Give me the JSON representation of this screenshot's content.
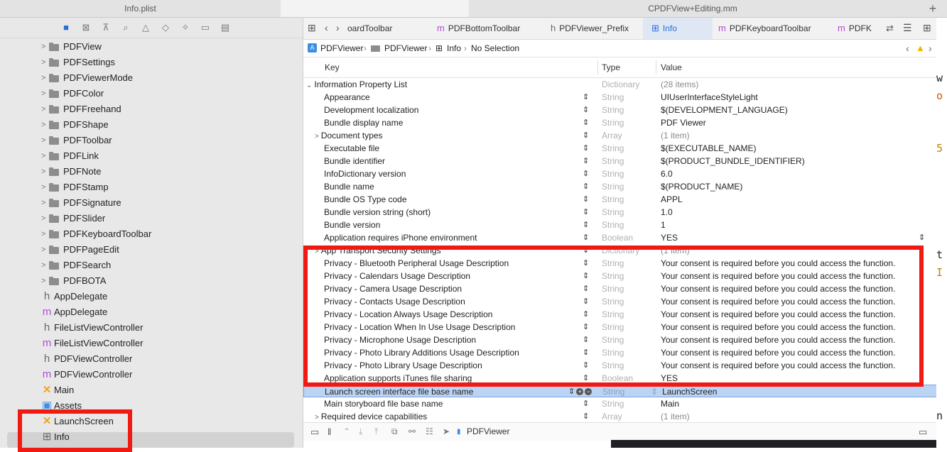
{
  "window_tabs": {
    "left": "Info.plist",
    "right": "CPDFView+Editing.mm",
    "plus": "+"
  },
  "navigator": {
    "toolbar_icons": [
      "folder-icon",
      "source-control-icon",
      "symbol-icon",
      "find-icon",
      "issue-icon",
      "test-icon",
      "debug-icon",
      "breakpoint-icon",
      "report-icon"
    ],
    "folders": [
      "PDFView",
      "PDFSettings",
      "PDFViewerMode",
      "PDFColor",
      "PDFFreehand",
      "PDFShape",
      "PDFToolbar",
      "PDFLink",
      "PDFNote",
      "PDFStamp",
      "PDFSignature",
      "PDFSlider",
      "PDFKeyboardToolbar",
      "PDFPageEdit",
      "PDFSearch",
      "PDFBOTA"
    ],
    "files": [
      {
        "icon": "h",
        "name": "AppDelegate"
      },
      {
        "icon": "m",
        "name": "AppDelegate"
      },
      {
        "icon": "h",
        "name": "FileListViewController"
      },
      {
        "icon": "m",
        "name": "FileListViewController"
      },
      {
        "icon": "h",
        "name": "PDFViewController"
      },
      {
        "icon": "m",
        "name": "PDFViewController"
      },
      {
        "icon": "✕",
        "name": "Main"
      },
      {
        "icon": "▣",
        "name": "Assets"
      },
      {
        "icon": "✕",
        "name": "LaunchScreen"
      },
      {
        "icon": "⊞",
        "name": "Info"
      }
    ]
  },
  "editor_tabs": [
    {
      "icon": "",
      "label": "oardToolbar"
    },
    {
      "icon": "m",
      "label": "PDFBottomToolbar"
    },
    {
      "icon": "h",
      "label": "PDFViewer_Prefix"
    },
    {
      "icon": "⊞",
      "label": "Info"
    },
    {
      "icon": "m",
      "label": "PDFKeyboardToolbar"
    },
    {
      "icon": "m",
      "label": "PDFK"
    }
  ],
  "jumpbar": {
    "project": "PDFViewer",
    "group": "PDFViewer",
    "file": "Info",
    "selection": "No Selection"
  },
  "columns": {
    "key": "Key",
    "type": "Type",
    "value": "Value"
  },
  "plist": {
    "root": {
      "key": "Information Property List",
      "type": "Dictionary",
      "value": "(28 items)"
    },
    "rows": [
      {
        "key": "Appearance",
        "type": "String",
        "value": "UIUserInterfaceStyleLight"
      },
      {
        "key": "Development localization",
        "type": "String",
        "value": "$(DEVELOPMENT_LANGUAGE)"
      },
      {
        "key": "Bundle display name",
        "type": "String",
        "value": "PDF Viewer"
      },
      {
        "key": "Document types",
        "type": "Array",
        "value": "(1 item)",
        "expandable": true
      },
      {
        "key": "Executable file",
        "type": "String",
        "value": "$(EXECUTABLE_NAME)"
      },
      {
        "key": "Bundle identifier",
        "type": "String",
        "value": "$(PRODUCT_BUNDLE_IDENTIFIER)"
      },
      {
        "key": "InfoDictionary version",
        "type": "String",
        "value": "6.0"
      },
      {
        "key": "Bundle name",
        "type": "String",
        "value": "$(PRODUCT_NAME)"
      },
      {
        "key": "Bundle OS Type code",
        "type": "String",
        "value": "APPL"
      },
      {
        "key": "Bundle version string (short)",
        "type": "String",
        "value": "1.0"
      },
      {
        "key": "Bundle version",
        "type": "String",
        "value": "1"
      },
      {
        "key": "Application requires iPhone environment",
        "type": "Boolean",
        "value": "YES",
        "stepper2": true
      },
      {
        "key": "App Transport Security Settings",
        "type": "Dictionary",
        "value": "(1 item)",
        "expandable": true
      },
      {
        "key": "Privacy - Bluetooth Peripheral Usage Description",
        "type": "String",
        "value": "Your consent is required before you could access the function."
      },
      {
        "key": "Privacy - Calendars Usage Description",
        "type": "String",
        "value": "Your consent is required before you could access the function."
      },
      {
        "key": "Privacy - Camera Usage Description",
        "type": "String",
        "value": "Your consent is required before you could access the function."
      },
      {
        "key": "Privacy - Contacts Usage Description",
        "type": "String",
        "value": "Your consent is required before you could access the function."
      },
      {
        "key": "Privacy - Location Always Usage Description",
        "type": "String",
        "value": "Your consent is required before you could access the function."
      },
      {
        "key": "Privacy - Location When In Use Usage Description",
        "type": "String",
        "value": "Your consent is required before you could access the function."
      },
      {
        "key": "Privacy - Microphone Usage Description",
        "type": "String",
        "value": "Your consent is required before you could access the function."
      },
      {
        "key": "Privacy - Photo Library Additions Usage Description",
        "type": "String",
        "value": "Your consent is required before you could access the function."
      },
      {
        "key": "Privacy - Photo Library Usage Description",
        "type": "String",
        "value": "Your consent is required before you could access the function."
      },
      {
        "key": "Application supports iTunes file sharing",
        "type": "Boolean",
        "value": "YES",
        "stepper2": true
      },
      {
        "key": "Launch screen interface file base name",
        "type": "String",
        "value": "LaunchScreen",
        "selected": true
      },
      {
        "key": "Main storyboard file base name",
        "type": "String",
        "value": "Main"
      },
      {
        "key": "Required device capabilities",
        "type": "Array",
        "value": "(1 item)",
        "expandable": true
      }
    ]
  },
  "bottom_bar": {
    "scheme": "PDFViewer"
  },
  "code_peek": [
    "w",
    "o",
    "5",
    "t",
    "I",
    "n"
  ],
  "colors": {
    "highlight": "#f01a12",
    "selection": "#bcd4f4",
    "accent": "#2a6fd6"
  }
}
